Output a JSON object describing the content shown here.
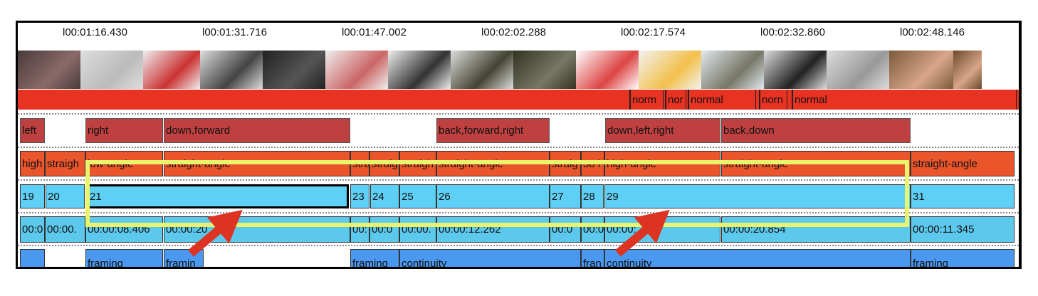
{
  "ruler": {
    "ticks": [
      "l00:01:16.430",
      "l00:01:31.716",
      "l00:01:47.002",
      "l00:02:02.288",
      "l00:02:17.574",
      "l00:02:32.860",
      "l00:02:48.146"
    ]
  },
  "thumbnails": {
    "count": 17
  },
  "speed_track": {
    "labels": [
      "norm",
      "nor",
      "normal",
      "norn",
      "normal"
    ],
    "color": "#e83222"
  },
  "direction_track": {
    "labels": [
      "left",
      "right",
      "down,forward",
      "back,forward,right",
      "down,left,right",
      "back,down"
    ],
    "color": "#bf4040"
  },
  "angle_track": {
    "labels": [
      "high",
      "straigh",
      "low-angle",
      "straight-angle",
      "stra",
      "straig",
      "straigh",
      "straight-angle",
      "straig",
      "38 l",
      "high-angle",
      "straight-angle",
      "straight-angle"
    ],
    "color": "#ea552c"
  },
  "shot_track": {
    "labels": [
      "19",
      "20",
      "21",
      "23",
      "24",
      "25",
      "26",
      "27",
      "28",
      "29",
      "31"
    ],
    "selected": "21",
    "color": "#5fd0f5"
  },
  "duration_track": {
    "labels": [
      "00:0",
      "00:00.",
      "00:00:08.406",
      "00:00:20",
      "00:",
      "00:0",
      "00:00.",
      "00:00:12.262",
      "00:0",
      "00:0",
      "00:00:…96",
      "00:00:20.854",
      "00:00:11.345"
    ]
  },
  "transition_track": {
    "labels": [
      "",
      "framing",
      "framin",
      "framing",
      "continuity",
      "fran",
      "continuity",
      "framing"
    ],
    "color": "#4a98f0"
  },
  "annotation": {
    "highlight_color": "#e9f56a",
    "arrow_color": "#dd3322"
  }
}
